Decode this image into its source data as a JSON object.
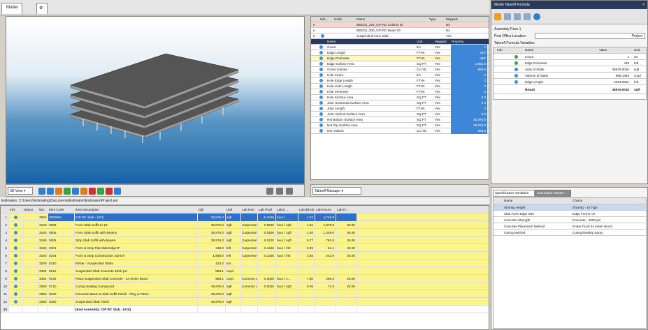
{
  "tabs": {
    "model": "Model"
  },
  "viewport": {
    "view_label": "3D View"
  },
  "formula_manager": {
    "label": "Takeoff Manager"
  },
  "takeoff_grid": {
    "headers": [
      "Info",
      "Code",
      "Name",
      "Type",
      "Mapped"
    ],
    "items": [
      {
        "info": "e",
        "name": "BEEO1_240_CIP RC Column ID",
        "mapped": "No"
      },
      {
        "info": "e",
        "name": "BEEO1_300_CIP RC Beam ID",
        "mapped": "No"
      },
      {
        "info": "e",
        "name": "Suspended Conc Slab",
        "mapped": "Yes"
      }
    ],
    "sub_headers": [
      "Name",
      "Unit",
      "Mapped",
      "Property"
    ],
    "props": [
      {
        "name": "Count",
        "unit": "EA",
        "mapped": "Yes",
        "value": "1"
      },
      {
        "name": "Edge Length",
        "unit": "FT-IN",
        "mapped": "Yes",
        "value": "244'"
      },
      {
        "name": "Edge Perimeter",
        "unit": "FT-IN",
        "mapped": "Yes",
        "value": "448'"
      },
      {
        "name": "Edge Surface Area",
        "unit": "SQ FT",
        "mapped": "Yes",
        "value": "1,982.0"
      },
      {
        "name": "Gross Volume",
        "unit": "CU YD",
        "mapped": "Yes",
        "value": "886.5"
      },
      {
        "name": "Hole Count",
        "unit": "EA",
        "mapped": "Yes",
        "value": "0"
      },
      {
        "name": "Hole Edge Length",
        "unit": "FT-IN",
        "mapped": "Yes",
        "value": "0"
      },
      {
        "name": "Hole Joint Length",
        "unit": "FT-IN",
        "mapped": "Yes",
        "value": "0"
      },
      {
        "name": "Hole Perimeter",
        "unit": "FT-IN",
        "mapped": "Yes",
        "value": "0"
      },
      {
        "name": "Hole Surface Area",
        "unit": "SQ FT",
        "mapped": "Yes",
        "value": "0.0"
      },
      {
        "name": "Joint Horizontal Surface Area",
        "unit": "SQ FT",
        "mapped": "Yes",
        "value": "0.0"
      },
      {
        "name": "Joint Length",
        "unit": "FT-IN",
        "mapped": "Yes",
        "value": "0"
      },
      {
        "name": "Joint Vertical Surface Area",
        "unit": "SQ FT",
        "mapped": "Yes",
        "value": "0.0"
      },
      {
        "name": "Net Bottom Surface Area",
        "unit": "SQ FT",
        "mapped": "Yes",
        "value": "35,976.0"
      },
      {
        "name": "Net Top Surface Area",
        "unit": "SQ FT",
        "mapped": "Yes",
        "value": "35,976.0"
      },
      {
        "name": "Net Volume",
        "unit": "CU YD",
        "mapped": "Yes",
        "value": "886.5"
      }
    ]
  },
  "est_path": "Estimates: C:\\Users\\Estimating\\Documents\\Estimator\\Estimates\\Project.est",
  "estimate_grid": {
    "headers": [
      "",
      "Info",
      "Status",
      "WC",
      "Item Code",
      "Item Description",
      "Qty",
      "Unit",
      "Lab Res",
      "Lab Prod",
      "Labor ...",
      "Lab $/Unit",
      "Lab Hours",
      "Lab R..."
    ],
    "rows": [
      {
        "num": "1",
        "wc": "3060",
        "code": "3000001",
        "desc": "CIP RC Slab - (VO)",
        "qty": "35,976.0",
        "unit": "sqft",
        "res": "",
        "prod": "0.1535",
        "labor": "hour /",
        "rate": "4.23",
        "hours": "4,745.8",
        "labr": "",
        "style": "sel"
      },
      {
        "num": "2",
        "wc": "3160",
        "code": "0003",
        "desc": "Form Slab Soffit to 10'",
        "qty": "35,976.0",
        "unit": "sqft",
        "res": "Carpenters",
        "prod": "0.0520",
        "labor": "hour / sqft",
        "rate": "1.62",
        "hours": "1,870.8",
        "labr": "35.00",
        "style": "y"
      },
      {
        "num": "3",
        "wc": "3160",
        "code": "0005",
        "desc": "Form Slab Soffit with Beams",
        "qty": "35,976.0",
        "unit": "sqft",
        "res": "Carpenters",
        "prod": "0.0400",
        "labor": "hour / sqft",
        "rate": "1.40",
        "hours": "1,439.0",
        "labr": "35.00",
        "style": "y"
      },
      {
        "num": "4",
        "wc": "3160",
        "code": "0006",
        "desc": "Strip Slab Soffit with Beams",
        "qty": "35,976.0",
        "unit": "sqft",
        "res": "Carpenters",
        "prod": "0.0220",
        "labor": "hour / sqft",
        "rate": "0.77",
        "hours": "791.5",
        "labr": "35.00",
        "style": "y"
      },
      {
        "num": "5",
        "wc": "3160",
        "code": "0201",
        "desc": "Form & Strip Flat Slab Edge 8\"",
        "qty": "448.0",
        "unit": "lnft",
        "res": "Carpenters",
        "prod": "0.1140",
        "labor": "hour / lnft",
        "rate": "3.99",
        "hours": "51.1",
        "labr": "35.00",
        "style": "y"
      },
      {
        "num": "6",
        "wc": "3160",
        "code": "0244",
        "desc": "Form & Strip Construction Joint 8\"",
        "qty": "1,868.0",
        "unit": "lnft",
        "res": "Carpenters",
        "prod": "0.1300",
        "labor": "hour / lnft",
        "rate": "4.55",
        "hours": "242.8",
        "labr": "35.00",
        "style": "y"
      },
      {
        "num": "7",
        "wc": "3200",
        "code": "0310",
        "desc": "Rebar - Suspended Slabs",
        "qty": "122.2",
        "unit": "ton",
        "res": "",
        "prod": "",
        "labor": "",
        "rate": "",
        "hours": "",
        "labr": "",
        "style": "y"
      },
      {
        "num": "8",
        "wc": "3304",
        "code": "0012",
        "desc": "Suspended Slab Concrete 4000 psi",
        "qty": "888.1",
        "unit": "cuyd",
        "res": "",
        "prod": "",
        "labor": "",
        "rate": "",
        "hours": "",
        "labr": "",
        "style": "y"
      },
      {
        "num": "9",
        "wc": "3304",
        "code": "0149",
        "desc": "Place Suspended Slab Concrete - 24 meter Boom",
        "qty": "888.1",
        "unit": "cuyd",
        "res": "Common L...",
        "prod": "0.3000",
        "labor": "hour / c...",
        "rate": "7.50",
        "hours": "266.4",
        "labr": "25.00",
        "style": "y"
      },
      {
        "num": "10",
        "wc": "3360",
        "code": "0710",
        "desc": "Curing Sealing Compound",
        "qty": "35,976.0",
        "unit": "sqft",
        "res": "Common L...",
        "prod": "0.0020",
        "labor": "hour / sqft",
        "rate": "0.05",
        "hours": "71.9",
        "labr": "25.00",
        "style": "y"
      },
      {
        "num": "11",
        "wc": "3360",
        "code": "0040",
        "desc": "Concrete Beam & Slab Soffit Finish - Plug & Patch",
        "qty": "35,976.0",
        "unit": "sqft",
        "res": "",
        "prod": "",
        "labor": "",
        "rate": "",
        "hours": "",
        "labr": "",
        "style": "y"
      },
      {
        "num": "12",
        "wc": "3360",
        "code": "0320",
        "desc": "Suspended Slab Finish",
        "qty": "35,976.0",
        "unit": "sqft",
        "res": "",
        "prod": "",
        "labor": "",
        "rate": "",
        "hours": "",
        "labr": "",
        "style": "y"
      },
      {
        "num": "13",
        "wc": "",
        "code": "",
        "desc": "(End Assembly: CIP RC Slab - (VO))",
        "qty": "",
        "unit": "",
        "res": "",
        "prod": "",
        "labor": "",
        "rate": "",
        "hours": "",
        "labr": "",
        "style": "end"
      }
    ]
  },
  "right_panel": {
    "title": "Model Takeoff Formula",
    "assembly_pass": "Assembly Pass 1",
    "post_office_label": "Post Office Location:",
    "post_office_value": "Project",
    "formula_label": "Takeoff Formula Variables",
    "headers": [
      "Info",
      "Name",
      "Value",
      "Unit"
    ],
    "vars": [
      {
        "name": "Count",
        "value": "1",
        "unit": "ea"
      },
      {
        "name": "Edge Perimeter",
        "value": "448",
        "unit": "lnft"
      },
      {
        "name": "Area of Slabs",
        "value": "35976.0015",
        "unit": "sqft"
      },
      {
        "name": "Volume of Slabs",
        "value": "888.1484",
        "unit": "cuyd"
      },
      {
        "name": "Edge Length",
        "value": "2404.0081",
        "unit": "lnft"
      }
    ],
    "result_label": "Result",
    "result_value": "35976.0015",
    "result_unit": "sqft"
  },
  "spec_panel": {
    "tabs": [
      "Specification Variables",
      "Calculation Tables"
    ],
    "headers": [
      "Name",
      "Choice"
    ],
    "rows": [
      {
        "name": "Shoring Height",
        "choice": "Shoring - 10' high"
      },
      {
        "name": "Slab Form Edge Size",
        "choice": "Edge Forms <8\""
      },
      {
        "name": "Concrete Strength",
        "choice": "Concrete - 4000 psi"
      },
      {
        "name": "Concrete Placement Method",
        "choice": "Pump Truck 24 meter Boom"
      },
      {
        "name": "Curing Method",
        "choice": "Curing/Sealing Spray"
      }
    ]
  }
}
